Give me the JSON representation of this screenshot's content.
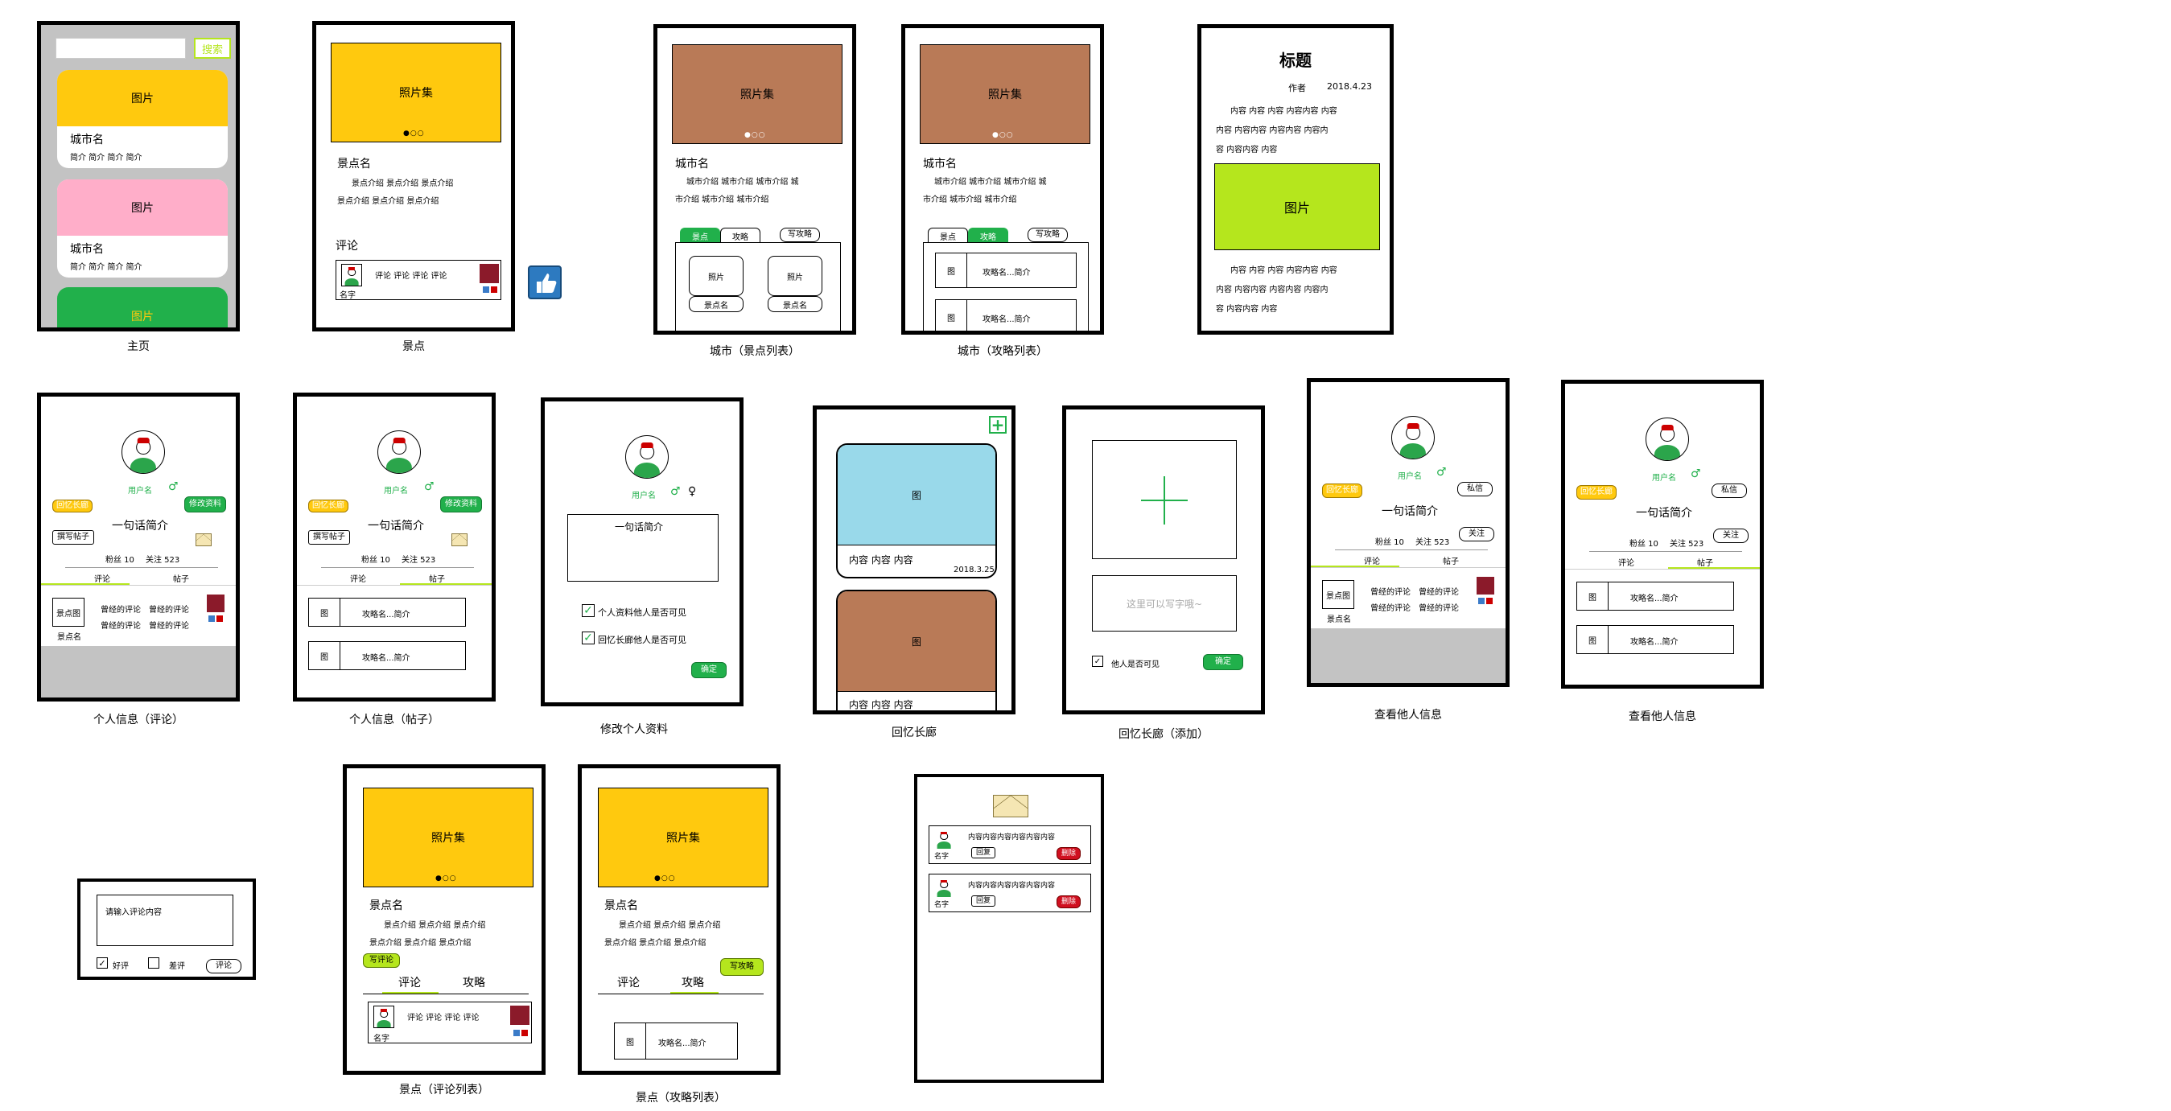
{
  "colors": {
    "yellow": "#ffc90e",
    "pink": "#ffaec9",
    "green": "#21b04b",
    "brown": "#b97a57",
    "lime": "#b5e61d",
    "lightblue": "#99d9ea",
    "gray": "#c3c3c3",
    "red": "#d01020"
  },
  "captions": {
    "home": "主页",
    "spot": "景点",
    "city_spots": "城市（景点列表）",
    "city_guides": "城市（攻略列表）",
    "profile_comments": "个人信息（评论）",
    "profile_posts": "个人信息（帖子）",
    "edit_profile": "修改个人资料",
    "memory": "回忆长廊",
    "memory_add": "回忆长廊（添加）",
    "other1": "查看他人信息",
    "other2": "查看他人信息",
    "spot_comments": "景点（评论列表）",
    "spot_guides": "景点（攻略列表）"
  },
  "home": {
    "search_btn": "搜索",
    "card1_img": "图片",
    "card2_img": "图片",
    "card3_img": "图片",
    "city_name": "城市名",
    "intro": "简介  简介  简介  简介"
  },
  "spot": {
    "gallery": "照片集",
    "name": "景点名",
    "intro_row1": "景点介绍  景点介绍  景点介绍",
    "intro_row2": "景点介绍  景点介绍  景点介绍",
    "comments_title": "评论",
    "comment_text": "评论  评论  评论  评论",
    "user_name": "名字"
  },
  "city1": {
    "gallery": "照片集",
    "name": "城市名",
    "intro_row1": "城市介绍  城市介绍  城市介绍  城",
    "intro_row2": "市介绍  城市介绍  城市介绍",
    "tab_spots": "景点",
    "tab_guides": "攻略",
    "write_guide": "写攻略",
    "photo": "照片",
    "spot_name": "景点名"
  },
  "city2": {
    "gallery": "照片集",
    "name": "城市名",
    "intro_row1": "城市介绍  城市介绍  城市介绍  城",
    "intro_row2": "市介绍  城市介绍  城市介绍",
    "tab_spots": "景点",
    "tab_guides": "攻略",
    "write_guide": "写攻略",
    "img": "图",
    "guide": "攻略名...简介"
  },
  "article": {
    "title": "标题",
    "author": "作者",
    "date": "2018.4.23",
    "p1": [
      "内容 内容 内容 内容内容 内容",
      "内容 内容内容 内容内容 内容内",
      "容 内容内容 内容"
    ],
    "img": "图片",
    "p2": [
      "内容 内容 内容 内容内容 内容",
      "内容 内容内容 内容内容 内容内",
      "容 内容内容 内容"
    ]
  },
  "profile": {
    "username": "用户名",
    "male": "♂",
    "female": "♀",
    "memory_btn": "回忆长廊",
    "edit_btn": "修改资料",
    "bio": "一句话简介",
    "write_post": "撰写帖子",
    "fans": "粉丝 10",
    "follow": "关注 523",
    "tab_comments": "评论",
    "tab_posts": "帖子",
    "spot_img": "景点图",
    "spot_name": "景点名",
    "my_comment": "曾经的评论",
    "img": "图",
    "guide": "攻略名...简介"
  },
  "edit": {
    "username": "用户名",
    "bio": "一句话简介",
    "opt1": "个人资料他人是否可见",
    "opt2": "回忆长廊他人是否可见",
    "confirm": "确定"
  },
  "memory": {
    "img": "图",
    "content": "内容  内容  内容",
    "date": "2018.3.25",
    "content2": "内容  内容  内容"
  },
  "memory_add": {
    "placeholder": "这里可以写字哦~",
    "visible": "他人是否可见",
    "confirm": "确定"
  },
  "other": {
    "username": "用户名",
    "memory_btn": "回忆长廊",
    "dm": "私信",
    "bio": "一句话简介",
    "follow_btn": "关注",
    "fans": "粉丝 10",
    "follow": "关注 523",
    "tab_comments": "评论",
    "tab_posts": "帖子"
  },
  "comment_input": {
    "placeholder": "请输入评论内容",
    "good": "好评",
    "bad": "差评",
    "submit": "评论"
  },
  "spot_c": {
    "gallery": "照片集",
    "name": "景点名",
    "intro_row1": "景点介绍  景点介绍  景点介绍",
    "intro_row2": "景点介绍  景点介绍  景点介绍",
    "write_comment": "写评论",
    "tab_comments": "评论",
    "tab_guides": "攻略",
    "comment_text": "评论  评论  评论  评论",
    "user_name": "名字"
  },
  "spot_g": {
    "gallery": "照片集",
    "name": "景点名",
    "intro_row1": "景点介绍  景点介绍  景点介绍",
    "intro_row2": "景点介绍  景点介绍  景点介绍",
    "write_guide": "写攻略",
    "tab_comments": "评论",
    "tab_guides": "攻略",
    "img": "图",
    "guide": "攻略名...简介"
  },
  "messages": {
    "content": "内容内容内容内容内容内容",
    "reply": "回复",
    "delete": "删除",
    "user_name": "名字"
  }
}
